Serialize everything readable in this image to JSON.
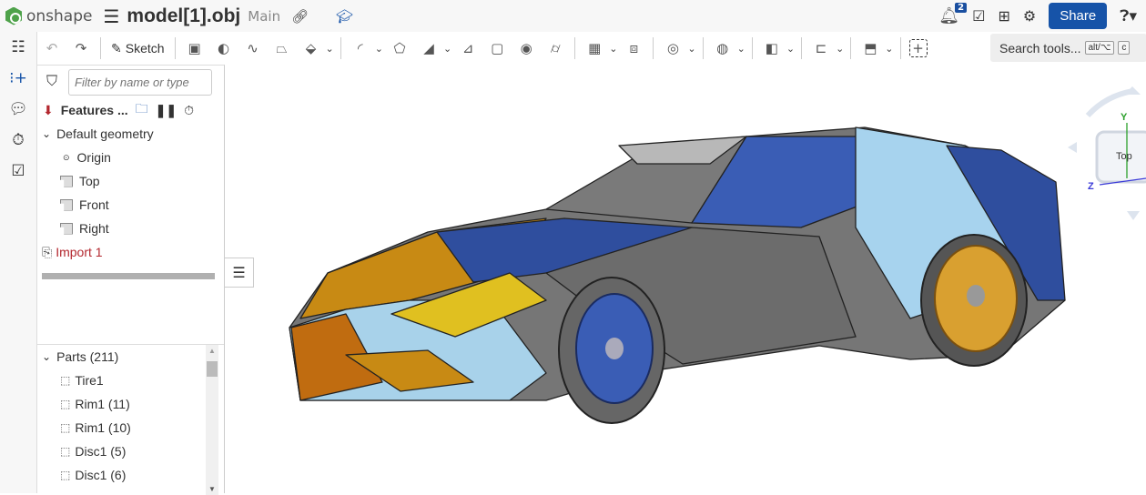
{
  "app": {
    "brand": "onshape",
    "doc_title": "model[1].obj",
    "branch": "Main",
    "notifications": "2",
    "share": "Share"
  },
  "toolbar": {
    "sketch": "Sketch",
    "search_tools": "Search tools...",
    "kbd1": "alt/⌥",
    "kbd2": "c"
  },
  "panel": {
    "filter_placeholder": "Filter by name or type",
    "features_label": "Features ...",
    "default_geometry": "Default geometry",
    "items": [
      "Origin",
      "Top",
      "Front",
      "Right"
    ],
    "import": "Import 1",
    "parts_header": "Parts (211)",
    "parts": [
      "Tire1",
      "Rim1 (11)",
      "Rim1 (10)",
      "Disc1 (5)",
      "Disc1 (6)"
    ]
  },
  "viewcube": {
    "face": "Top",
    "y": "Y",
    "z": "Z"
  },
  "colors": {
    "accent": "#1653a8",
    "import_error": "#b3262d",
    "logo": "#4ea24a"
  }
}
